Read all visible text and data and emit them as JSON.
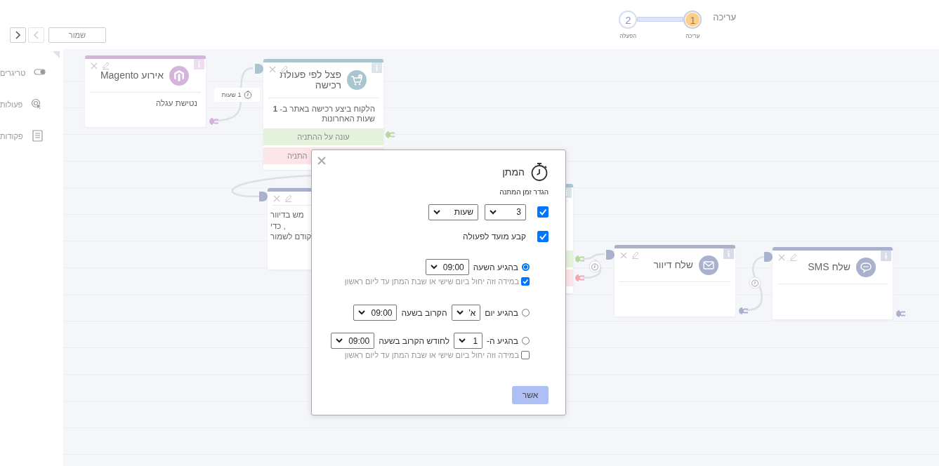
{
  "header": {
    "title": "עריכה",
    "steps": [
      {
        "number": "1",
        "label": "עריכה",
        "selected": true
      },
      {
        "number": "2",
        "label": "הפעלה",
        "selected": false
      }
    ]
  },
  "toolbar": {
    "save_label": "שמור",
    "nav": [
      {
        "kind": "next",
        "disabled": false
      },
      {
        "kind": "prev",
        "disabled": true
      }
    ]
  },
  "sidebar": {
    "items": [
      {
        "kind": "triggers",
        "label": "טריגרים"
      },
      {
        "kind": "actions",
        "label": "פעולות"
      },
      {
        "kind": "commands",
        "label": "פקודות"
      }
    ]
  },
  "canvas": {
    "delay_label": "1 שעות",
    "nodes": [
      {
        "kind": "split",
        "color": "#a9c5d0",
        "title": "פצל לפי פעולת רכישה",
        "description": [
          "הלקוח ביצע רכישה באתר ב- **1** שעות האחרונות"
        ],
        "branches": [
          {
            "kind": "yes",
            "label": "עונה על ההתניה"
          },
          {
            "kind": "no",
            "label": "התניה"
          }
        ]
      },
      {
        "kind": "magento",
        "color": "#d4b4db",
        "title": "אירוע Magento",
        "description": [
          "נטישת עגלה"
        ]
      },
      {
        "kind": "covered",
        "color": "#a9c5d0",
        "branches": [
          {
            "kind": "yes"
          },
          {
            "kind": "no"
          }
        ]
      },
      {
        "kind": "covered",
        "color": "#aab1cc",
        "description": [
          "מש בדיוור",
          "כדי ,",
          "קודם לשמור"
        ]
      },
      {
        "kind": "sms",
        "color": "#aab1cc",
        "title": "שלח SMS"
      },
      {
        "kind": "email",
        "color": "#aab1cc",
        "title": "שלח דיוור"
      }
    ]
  },
  "modal": {
    "title": "המתן",
    "subtitle": "הגדר זמן המתנה",
    "delay": {
      "checked": true,
      "amount": "3",
      "unit": "שעות"
    },
    "schedule": {
      "checked": true,
      "label": "קבע מועד לפעולה"
    },
    "options": [
      {
        "selected": true,
        "parts": [
          {
            "kind": "text",
            "text": "בהגיע השעה"
          },
          {
            "kind": "select",
            "value": "09:00"
          }
        ],
        "weekend": {
          "checked": true,
          "label": "במידה וזה יחול ביום שישי או שבת המתן עד ליום ראשון"
        }
      },
      {
        "selected": false,
        "parts": [
          {
            "kind": "text",
            "text": "בהגיע יום"
          },
          {
            "kind": "select",
            "value": "א'"
          },
          {
            "kind": "text",
            "text": "הקרוב בשעה"
          },
          {
            "kind": "select",
            "value": "09:00"
          }
        ]
      },
      {
        "selected": false,
        "parts": [
          {
            "kind": "text",
            "text": "בהגיע ה-"
          },
          {
            "kind": "select",
            "value": "1"
          },
          {
            "kind": "text",
            "text": "לחודש הקרוב בשעה"
          },
          {
            "kind": "select",
            "value": "09:00"
          }
        ],
        "weekend": {
          "checked": false,
          "label": "במידה וזה יחול ביום שישי או שבת המתן עד ליום ראשון"
        }
      }
    ],
    "confirm_label": "אשר"
  }
}
